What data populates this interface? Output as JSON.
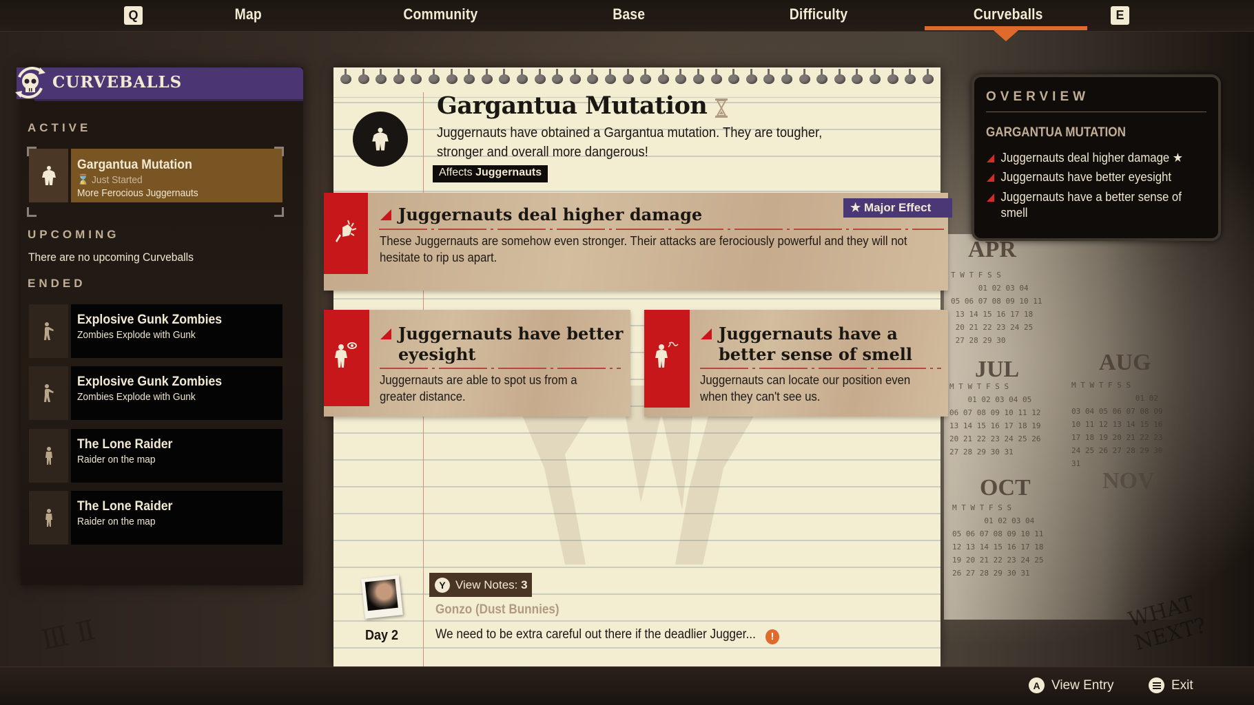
{
  "nav": {
    "left_key": "Q",
    "right_key": "E",
    "tabs": [
      "Map",
      "Community",
      "Base",
      "Difficulty",
      "Curveballs"
    ],
    "active_tab": "Curveballs",
    "accent_color": "#e06a2c"
  },
  "sidebar": {
    "title": "CURVEBALLS",
    "header_color": "#4b3572",
    "sections": {
      "active": "ACTIVE",
      "upcoming": "UPCOMING",
      "ended": "ENDED"
    },
    "active": [
      {
        "title": "Gargantua Mutation",
        "status": "Just Started",
        "subtitle": "More Ferocious Juggernauts",
        "icon": "juggernaut-icon"
      }
    ],
    "upcoming_empty": "There are no upcoming Curveballs",
    "ended": [
      {
        "title": "Explosive Gunk Zombies",
        "subtitle": "Zombies Explode with Gunk",
        "icon": "zombie-icon"
      },
      {
        "title": "Explosive Gunk Zombies",
        "subtitle": "Zombies Explode with Gunk",
        "icon": "zombie-icon"
      },
      {
        "title": "The Lone Raider",
        "subtitle": "Raider on the map",
        "icon": "raider-icon"
      },
      {
        "title": "The Lone Raider",
        "subtitle": "Raider on the map",
        "icon": "raider-icon"
      }
    ]
  },
  "detail": {
    "title": "Gargantua Mutation",
    "description": "Juggernauts have obtained a Gargantua mutation. They are tougher, stronger and overall more dangerous!",
    "affects_label": "Affects",
    "affects_value": "Juggernauts",
    "effects": [
      {
        "title": "Juggernauts deal higher damage",
        "description": "These Juggernauts are somehow even stronger. Their attacks are ferociously powerful and they will not hesitate to rip us apart.",
        "badge": "Major Effect",
        "icon": "fist-icon"
      },
      {
        "title": "Juggernauts have better eyesight",
        "description": "Juggernauts are able to spot us from a greater distance.",
        "icon": "eye-icon"
      },
      {
        "title": "Juggernauts have a better sense of smell",
        "description": "Juggernauts can locate our position even when they can't see us.",
        "icon": "smell-icon"
      }
    ]
  },
  "journal": {
    "view_notes_key": "Y",
    "view_notes_label": "View Notes:",
    "view_notes_count": "3",
    "author": "Gonzo (Dust Bunnies)",
    "day": "Day 2",
    "note": "We need to be extra careful out there if the deadlier Jugger...",
    "alert": "!"
  },
  "overview": {
    "title": "OVERVIEW",
    "subtitle": "GARGANTUA MUTATION",
    "items": [
      {
        "text": "Juggernauts deal higher damage",
        "major": "★"
      },
      {
        "text": "Juggernauts have better eyesight"
      },
      {
        "text": "Juggernauts have a better sense of smell"
      }
    ]
  },
  "footer": {
    "view_entry_key": "A",
    "view_entry_label": "View Entry",
    "exit_label": "Exit"
  },
  "background": {
    "calendar_months": [
      "APR",
      "JUL",
      "AUG",
      "OCT",
      "NOV"
    ],
    "scrawl": "WHAT NEXT?"
  }
}
